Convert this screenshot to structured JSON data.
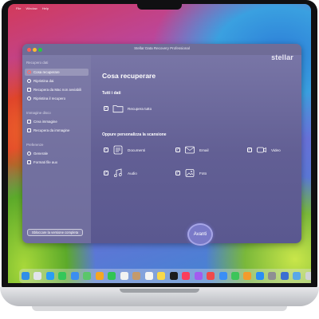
{
  "menubar": {
    "items": [
      "",
      "File",
      "Window",
      "Help"
    ]
  },
  "window": {
    "title": "Stellar Data Recovery Professional"
  },
  "brand": {
    "logo": "stellar"
  },
  "sidebar": {
    "section_recovery": "Recupero dati",
    "items": [
      {
        "label": "Cosa recuperare",
        "icon": "target-icon",
        "active": true
      },
      {
        "label": "Ripristina dai",
        "icon": "restore-icon"
      },
      {
        "label": "Recupera da Mac non avviabili",
        "icon": "mac-icon"
      },
      {
        "label": "Ripristina il recupero",
        "icon": "refresh-icon"
      }
    ],
    "section_image": "Immagine disco",
    "image_items": [
      {
        "label": "Crea immagine",
        "icon": "disk-image-icon"
      },
      {
        "label": "Recupera da immagine",
        "icon": "recover-image-icon"
      }
    ],
    "section_prefs": "Preferenze",
    "pref_items": [
      {
        "label": "Generale",
        "icon": "gear-icon"
      },
      {
        "label": "Formati file aux",
        "icon": "file-format-icon"
      }
    ],
    "upgrade_label": "Sbloccare la versione completa"
  },
  "content": {
    "title": "Cosa recuperare",
    "all_data_label": "Tutti i dati",
    "recover_all": "Recupera tutto",
    "custom_label": "Oppure personalizza la scansione",
    "options": [
      {
        "label": "Documenti",
        "icon": "document-icon"
      },
      {
        "label": "Email",
        "icon": "email-icon"
      },
      {
        "label": "Video",
        "icon": "video-icon"
      },
      {
        "label": "Audio",
        "icon": "audio-icon"
      },
      {
        "label": "Foto",
        "icon": "photo-icon"
      }
    ],
    "check_mark": "✓"
  },
  "next_button": {
    "label": "Avanti"
  },
  "dock": {
    "apps": [
      {
        "name": "finder-icon",
        "color": "#2f8fe8"
      },
      {
        "name": "launchpad-icon",
        "color": "#e1e4ea"
      },
      {
        "name": "safari-icon",
        "color": "#2a9df4"
      },
      {
        "name": "messages-icon",
        "color": "#34c759"
      },
      {
        "name": "mail-icon",
        "color": "#3b8ef0"
      },
      {
        "name": "maps-icon",
        "color": "#5bc66a"
      },
      {
        "name": "photos-icon",
        "color": "#f5a623"
      },
      {
        "name": "facetime-icon",
        "color": "#31c453"
      },
      {
        "name": "calendar-icon",
        "color": "#f2f2f2"
      },
      {
        "name": "contacts-icon",
        "color": "#c49a6c"
      },
      {
        "name": "reminders-icon",
        "color": "#f4f4f4"
      },
      {
        "name": "notes-icon",
        "color": "#f7d84a"
      },
      {
        "name": "tv-icon",
        "color": "#1c1c1e"
      },
      {
        "name": "music-icon",
        "color": "#fa3e5c"
      },
      {
        "name": "podcasts-icon",
        "color": "#a35cf0"
      },
      {
        "name": "news-icon",
        "color": "#f04a4a"
      },
      {
        "name": "keynote-icon",
        "color": "#3a8ef5"
      },
      {
        "name": "numbers-icon",
        "color": "#3cc55a"
      },
      {
        "name": "pages-icon",
        "color": "#f39b2c"
      },
      {
        "name": "app-store-icon",
        "color": "#2a8ef5"
      },
      {
        "name": "settings-icon",
        "color": "#8e8e93"
      },
      {
        "name": "stellar-app-icon",
        "color": "#3b6fd1"
      },
      {
        "name": "folder-icon",
        "color": "#5aa8e8"
      },
      {
        "name": "trash-icon",
        "color": "#cfd2d6"
      }
    ]
  }
}
